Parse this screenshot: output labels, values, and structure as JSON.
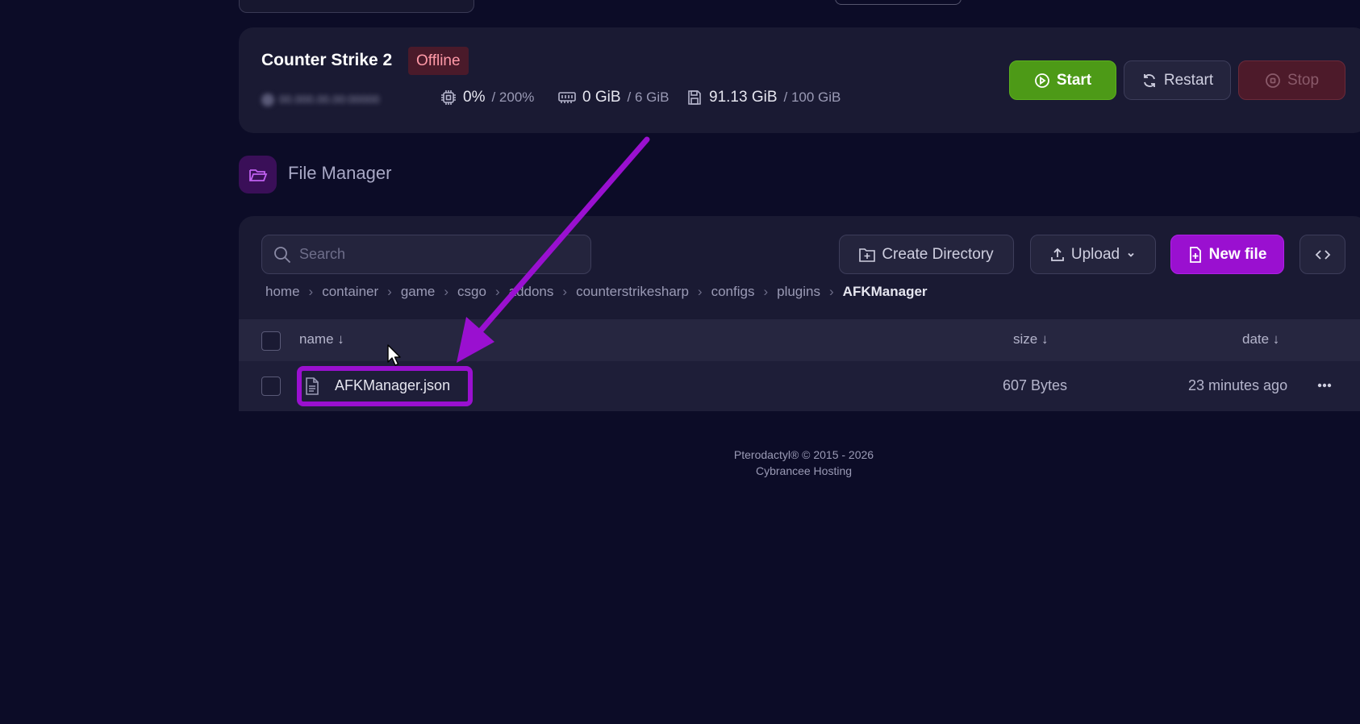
{
  "server": {
    "name": "Counter Strike 2",
    "status": "Offline",
    "address": "00.000.00.00:00000",
    "cpu": {
      "used": "0%",
      "limit": "/ 200%"
    },
    "memory": {
      "used": "0 GiB",
      "limit": "/ 6 GiB"
    },
    "disk": {
      "used": "91.13 GiB",
      "limit": "/ 100 GiB"
    },
    "controls": {
      "start": "Start",
      "restart": "Restart",
      "stop": "Stop"
    }
  },
  "file_manager": {
    "title": "File Manager",
    "search_placeholder": "Search",
    "actions": {
      "create_directory": "Create Directory",
      "upload": "Upload",
      "new_file": "New file"
    },
    "breadcrumb": [
      "home",
      "container",
      "game",
      "csgo",
      "addons",
      "counterstrikesharp",
      "configs",
      "plugins",
      "AFKManager"
    ],
    "columns": {
      "name": "name ↓",
      "size": "size ↓",
      "date": "date ↓"
    },
    "files": [
      {
        "name": "AFKManager.json",
        "size": "607 Bytes",
        "date": "23 minutes ago"
      }
    ]
  },
  "footer": {
    "line1": "Pterodactyl® © 2015 - 2026",
    "line2": "Cybrancee Hosting"
  },
  "colors": {
    "background": "#0c0c27",
    "card": "#1a1a33",
    "accent": "#9a10d0",
    "start": "#4d9a17",
    "offline": "#4a1a2a"
  }
}
